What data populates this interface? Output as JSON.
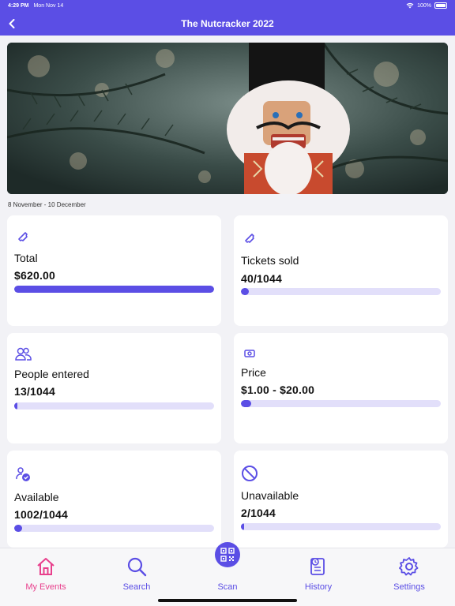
{
  "status": {
    "time": "4:29 PM",
    "date": "Mon Nov 14",
    "battery": "100%"
  },
  "header": {
    "title": "The Nutcracker 2022"
  },
  "event": {
    "dates": "8 November - 10 December"
  },
  "stats": {
    "total": {
      "label": "Total",
      "value": "$620.00",
      "progress": 1.0
    },
    "tickets_sold": {
      "label": "Tickets sold",
      "value": "40/1044",
      "progress": 0.038
    },
    "people_entered": {
      "label": "People entered",
      "value": "13/1044",
      "progress": 0.012
    },
    "price": {
      "label": "Price",
      "value": "$1.00 - $20.00",
      "progress": 0.05
    },
    "available": {
      "label": "Available",
      "value": "1002/1044",
      "progress": 0.04
    },
    "unavailable": {
      "label": "Unavailable",
      "value": "2/1044",
      "progress": 0.002
    }
  },
  "tabs": [
    {
      "label": "My Events",
      "icon": "home-icon"
    },
    {
      "label": "Search",
      "icon": "search-icon"
    },
    {
      "label": "Scan",
      "icon": "qr-code-icon"
    },
    {
      "label": "History",
      "icon": "history-icon"
    },
    {
      "label": "Settings",
      "icon": "gear-icon"
    }
  ],
  "colors": {
    "primary": "#5b4ee5",
    "active_tab": "#e83f8c",
    "progress_track": "#e2dffa"
  }
}
